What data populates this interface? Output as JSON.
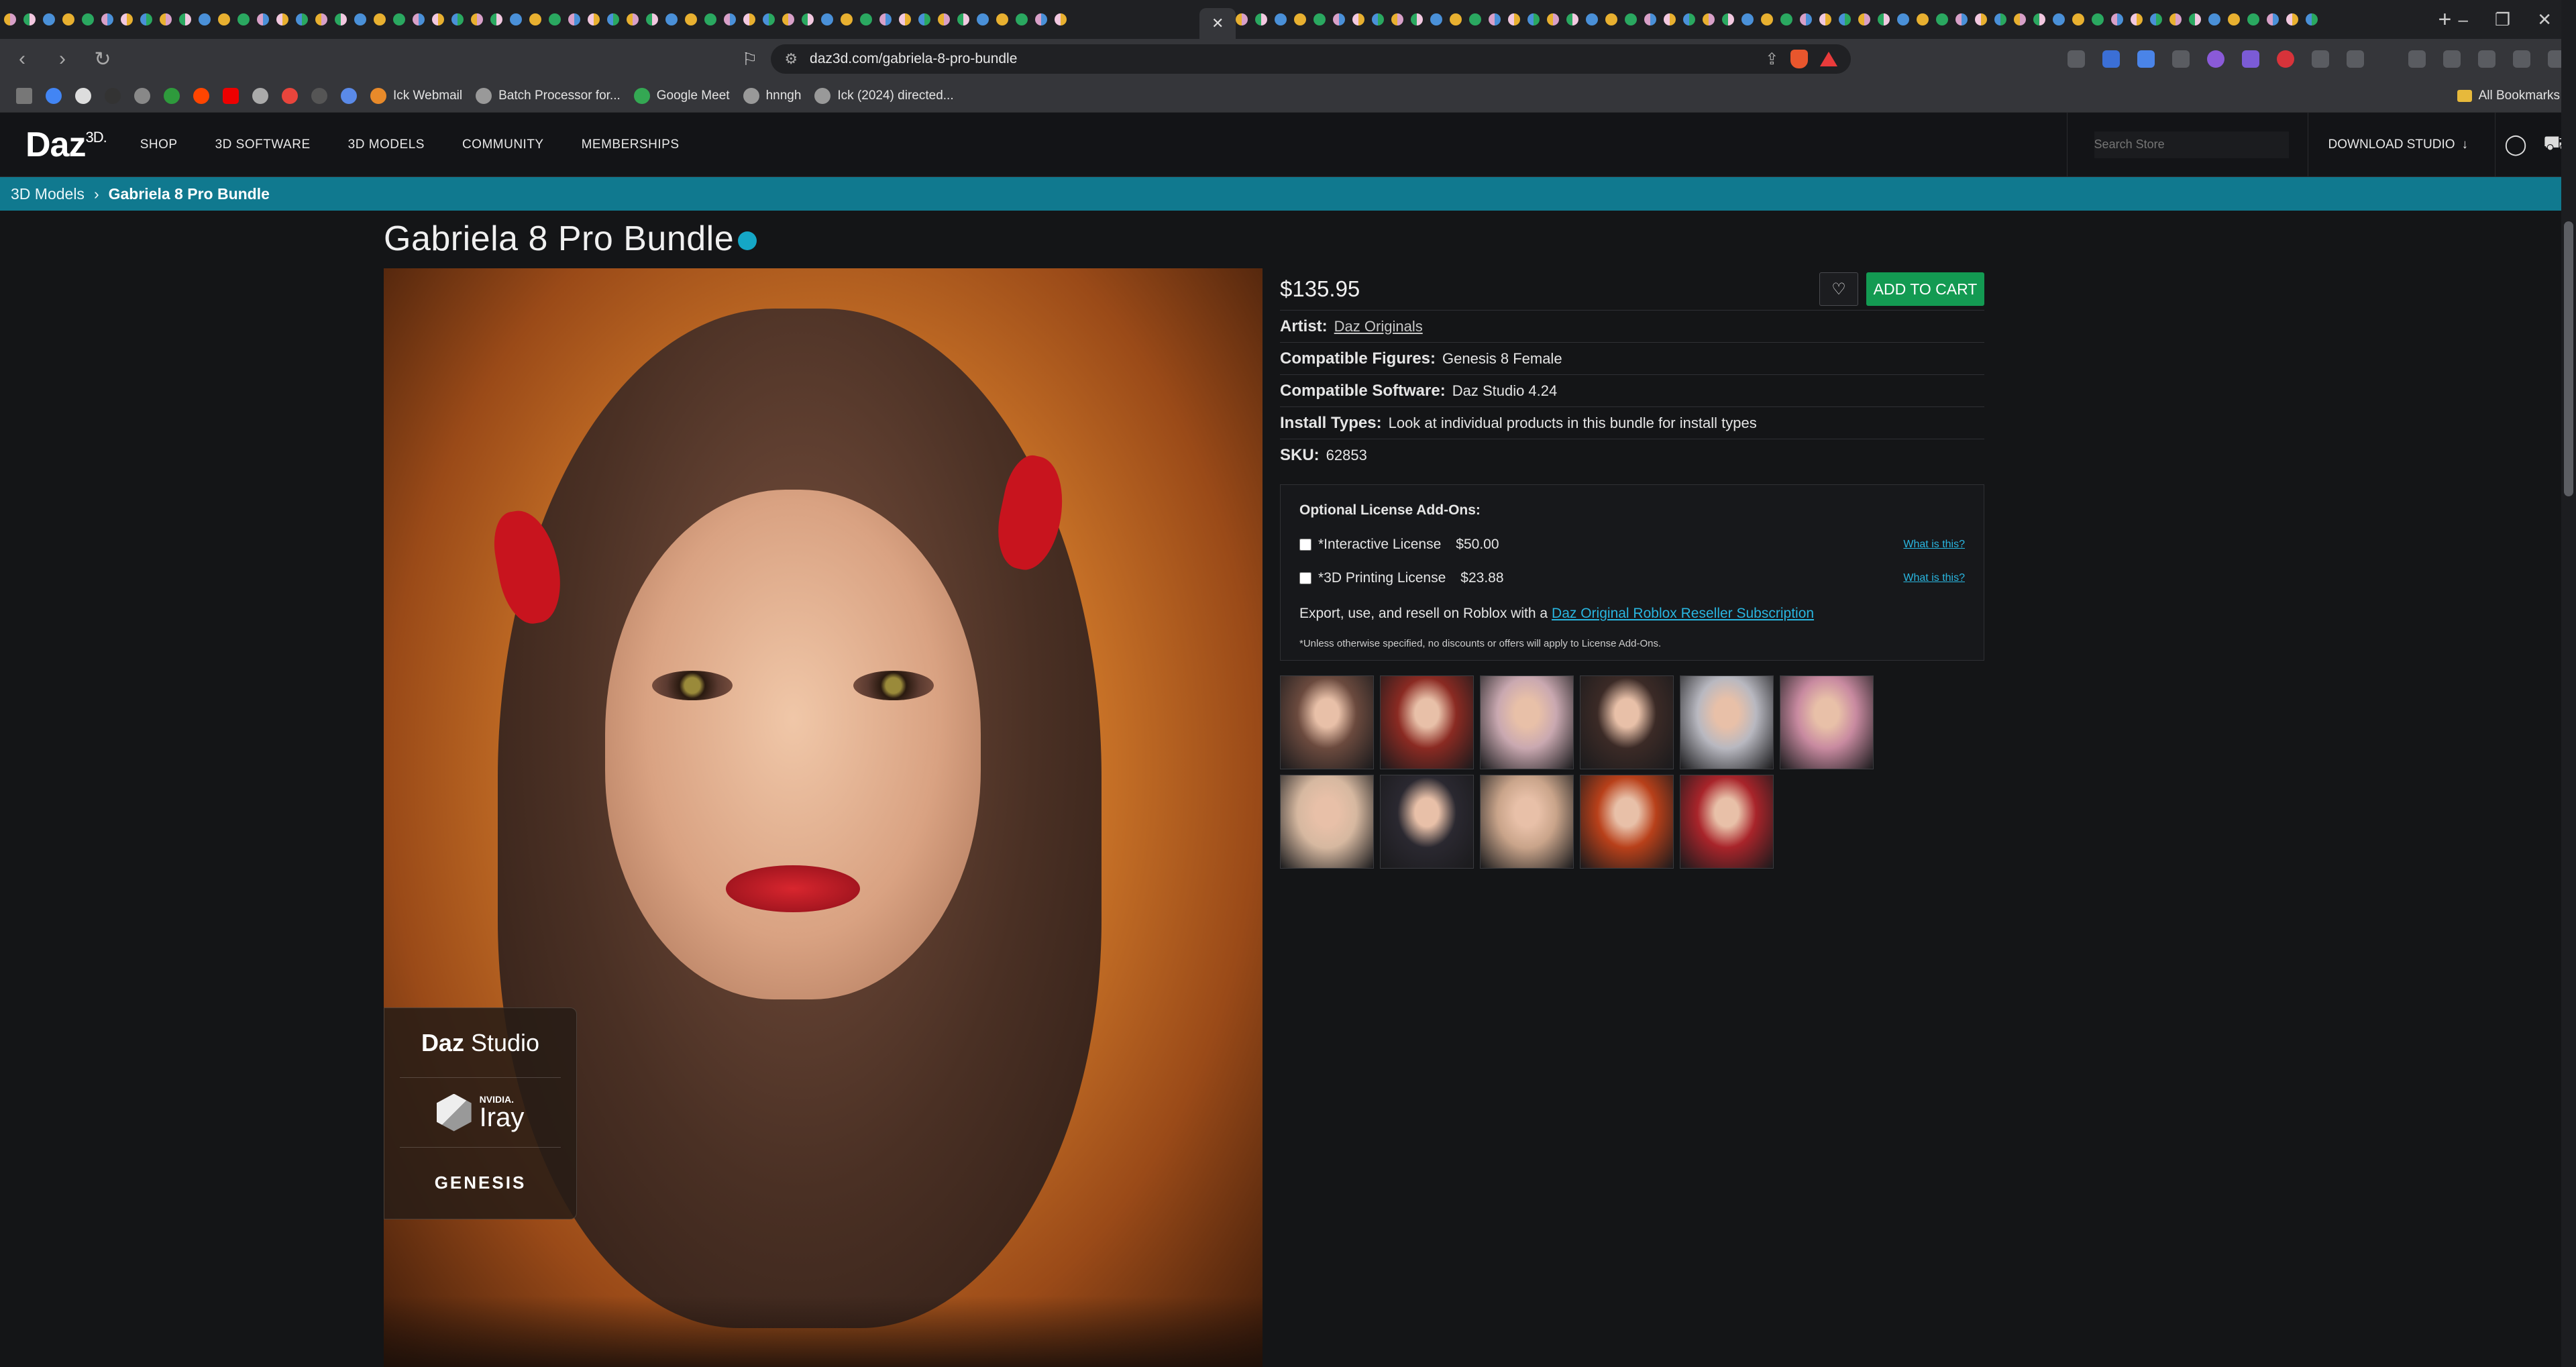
{
  "browser": {
    "url": "daz3d.com/gabriela-8-pro-bundle",
    "bookmarks": [
      "Ick Webmail",
      "Batch Processor for...",
      "Google Meet",
      "hnngh",
      "Ick (2024) directed..."
    ],
    "all_bookmarks": "All Bookmarks"
  },
  "site": {
    "logo": "Daz",
    "logo_sup": "3D.",
    "nav": [
      "SHOP",
      "3D SOFTWARE",
      "3D MODELS",
      "COMMUNITY",
      "MEMBERSHIPS"
    ],
    "search_placeholder": "Search Store",
    "download_label": "DOWNLOAD STUDIO"
  },
  "breadcrumb": {
    "parent": "3D Models",
    "separator": "›",
    "current": "Gabriela 8 Pro Bundle"
  },
  "product": {
    "title": "Gabriela 8 Pro Bundle",
    "price": "$135.95",
    "add_to_cart": "ADD TO CART",
    "specs": [
      {
        "label": "Artist:",
        "value": "Daz Originals",
        "link": true
      },
      {
        "label": "Compatible Figures:",
        "value": "Genesis 8 Female",
        "link": false
      },
      {
        "label": "Compatible Software:",
        "value": "Daz Studio 4.24",
        "link": false
      },
      {
        "label": "Install Types:",
        "value": "Look at individual products in this bundle for install types",
        "link": false
      },
      {
        "label": "SKU:",
        "value": "62853",
        "link": false
      }
    ],
    "badges": {
      "daz_bold": "Daz",
      "daz_rest": " Studio",
      "nvidia": "NVIDIA.",
      "iray": "Iray",
      "genesis": "GENESIS"
    }
  },
  "license": {
    "title": "Optional License Add-Ons:",
    "options": [
      {
        "name": "*Interactive License",
        "price": "$50.00",
        "help": "What is this?"
      },
      {
        "name": "*3D Printing License",
        "price": "$23.88",
        "help": "What is this?"
      }
    ],
    "export_text": "Export, use, and resell on Roblox with a",
    "export_link": "Daz Original Roblox Reseller Subscription",
    "note": "*Unless otherwise specified, no discounts or offers will apply to License Add-Ons."
  },
  "thumbnails": {
    "colors": [
      "#6b4a3e",
      "#8a2a22",
      "#c9a8b0",
      "#3b2a26",
      "#b8b8c0",
      "#c88aa0",
      "#d6b8a0",
      "#2a2830",
      "#c9a48a",
      "#b8401a",
      "#a8242a"
    ]
  },
  "colors": {
    "accent": "#10798f",
    "cart_button": "#139a52",
    "link": "#29b6e0"
  }
}
